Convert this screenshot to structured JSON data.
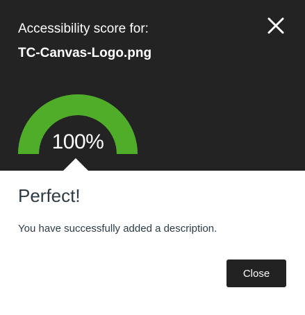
{
  "header": {
    "subtitle": "Accessibility score for:",
    "filename": "TC-Canvas-Logo.png"
  },
  "score": {
    "value": 100,
    "label": "100%",
    "gauge_color": "#4fad2a",
    "gauge_track_color": "#4fad2a"
  },
  "result": {
    "title": "Perfect!",
    "message": "You have successfully added a description."
  },
  "actions": {
    "close_label": "Close"
  },
  "icons": {
    "dismiss": "close-icon"
  },
  "colors": {
    "header_bg": "#232323",
    "button_bg": "#222222",
    "text_dark": "#2d3b45"
  }
}
